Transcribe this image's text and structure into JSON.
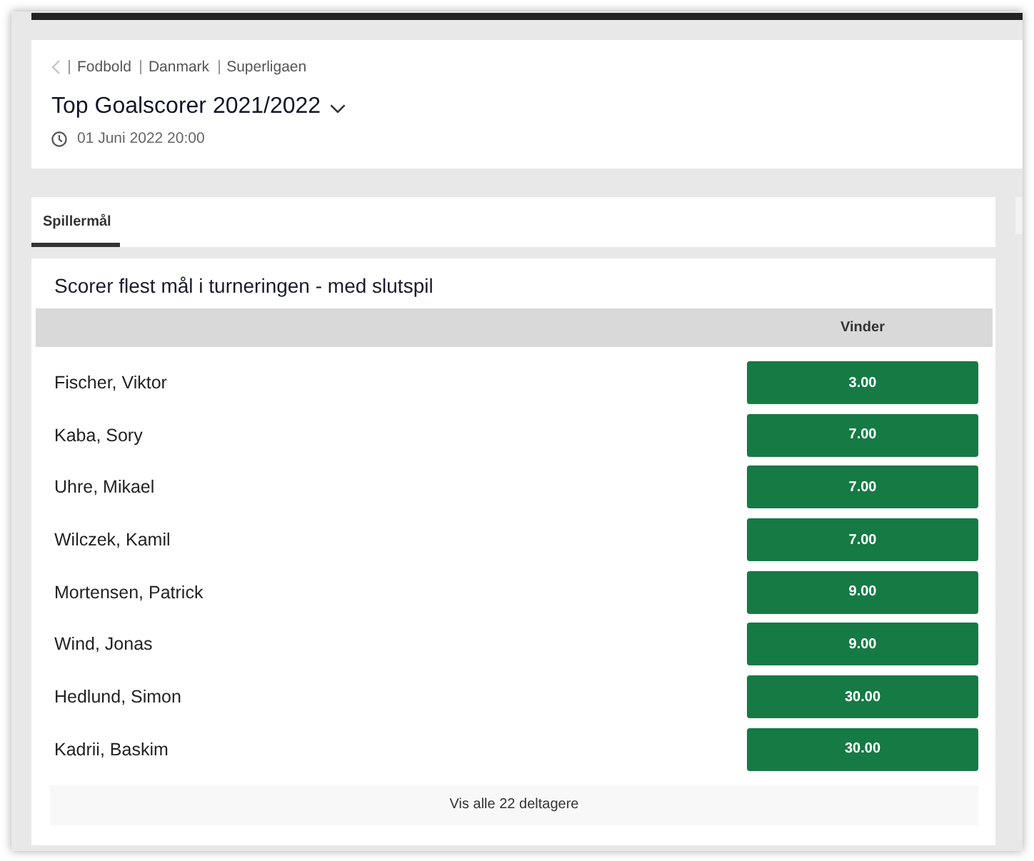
{
  "breadcrumb": {
    "items": [
      "Fodbold",
      "Danmark",
      "Superligaen"
    ]
  },
  "event": {
    "title": "Top Goalscorer 2021/2022",
    "date": "01 Juni 2022 20:00"
  },
  "tabs": [
    {
      "label": "Spillermål",
      "selected": true
    }
  ],
  "market": {
    "title": "Scorer flest mål i turneringen - med slutspil",
    "columns": [
      "Vinder"
    ],
    "rows": [
      {
        "name": "Fischer, Viktor",
        "odds": "3.00"
      },
      {
        "name": "Kaba, Sory",
        "odds": "7.00"
      },
      {
        "name": "Uhre, Mikael",
        "odds": "7.00"
      },
      {
        "name": "Wilczek, Kamil",
        "odds": "7.00"
      },
      {
        "name": "Mortensen, Patrick",
        "odds": "9.00"
      },
      {
        "name": "Wind, Jonas",
        "odds": "9.00"
      },
      {
        "name": "Hedlund, Simon",
        "odds": "30.00"
      },
      {
        "name": "Kadrii, Baskim",
        "odds": "30.00"
      }
    ],
    "show_all": "Vis alle 22 deltagere"
  }
}
